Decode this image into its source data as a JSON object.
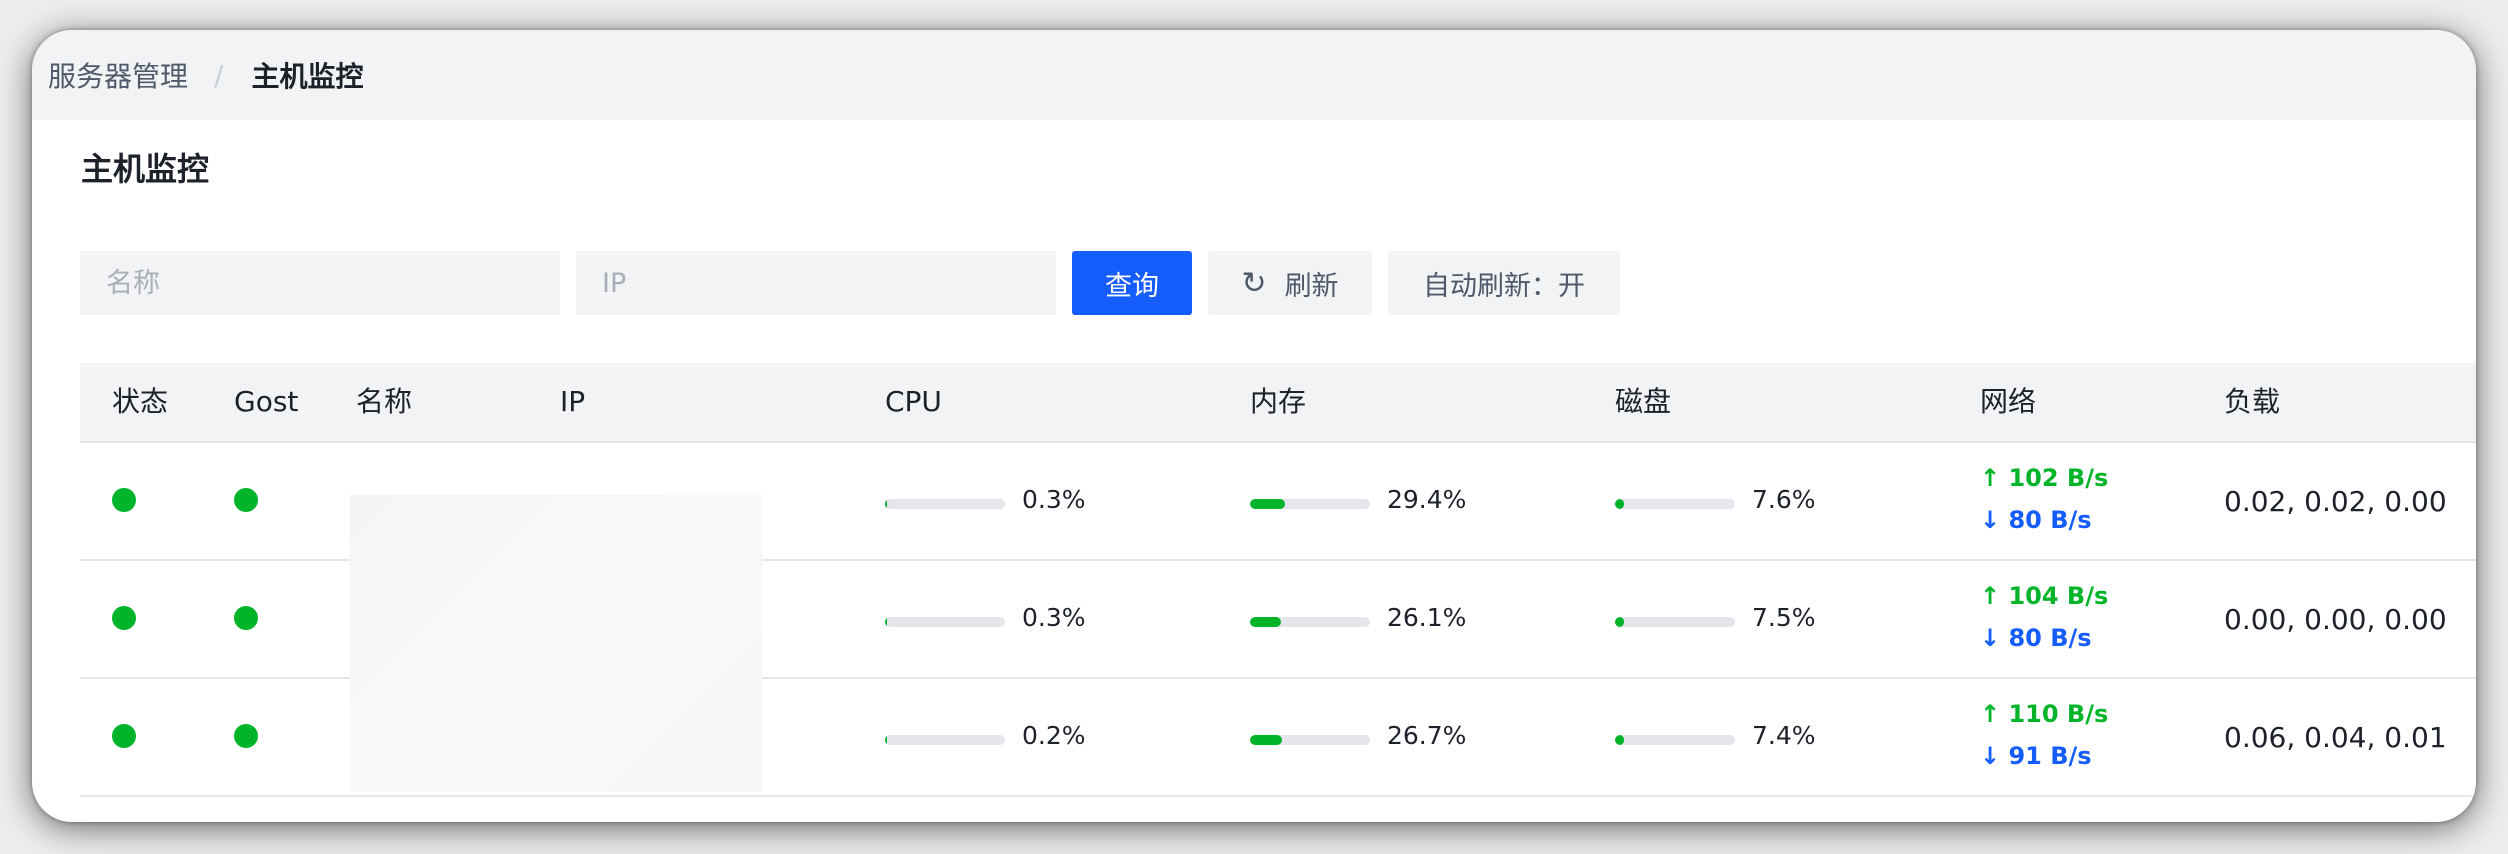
{
  "breadcrumb": {
    "parent": "服务器管理",
    "separator": "/",
    "current": "主机监控"
  },
  "page": {
    "title": "主机监控"
  },
  "toolbar": {
    "name_placeholder": "名称",
    "ip_placeholder": "IP",
    "query_label": "查询",
    "refresh_icon": "↻",
    "refresh_label": "刷新",
    "auto_refresh_label": "自动刷新：开"
  },
  "table": {
    "headers": [
      "状态",
      "Gost",
      "名称",
      "IP",
      "CPU",
      "内存",
      "磁盘",
      "网络",
      "负载"
    ],
    "rows": [
      {
        "status": "online",
        "gost": "online",
        "name": "",
        "ip": "",
        "cpu": {
          "text": "0.3%",
          "value": 0.3
        },
        "mem": {
          "text": "29.4%",
          "value": 29.4
        },
        "disk": {
          "text": "7.6%",
          "value": 7.6
        },
        "net_up": "↑ 102 B/s",
        "net_down": "↓ 80 B/s",
        "load": "0.02, 0.02, 0.00"
      },
      {
        "status": "online",
        "gost": "online",
        "name": "",
        "ip": "",
        "cpu": {
          "text": "0.3%",
          "value": 0.3
        },
        "mem": {
          "text": "26.1%",
          "value": 26.1
        },
        "disk": {
          "text": "7.5%",
          "value": 7.5
        },
        "net_up": "↑ 104 B/s",
        "net_down": "↓ 80 B/s",
        "load": "0.00, 0.00, 0.00"
      },
      {
        "status": "online",
        "gost": "online",
        "name": "",
        "ip": "",
        "cpu": {
          "text": "0.2%",
          "value": 0.2
        },
        "mem": {
          "text": "26.7%",
          "value": 26.7
        },
        "disk": {
          "text": "7.4%",
          "value": 7.4
        },
        "net_up": "↑ 110 B/s",
        "net_down": "↓ 91 B/s",
        "load": "0.06, 0.04, 0.01"
      }
    ]
  },
  "colors": {
    "primary": "#165dff",
    "success": "#00b42a",
    "track": "#e5e6eb",
    "header_bg": "#f2f3f5"
  }
}
